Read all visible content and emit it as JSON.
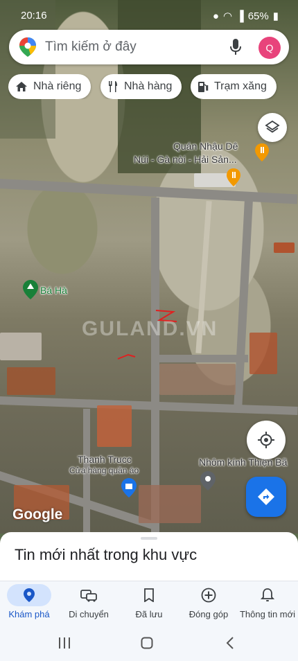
{
  "status": {
    "time": "20:16",
    "battery": "65%"
  },
  "search": {
    "placeholder": "Tìm kiếm ở đây",
    "avatar_letter": "Q"
  },
  "chips": [
    {
      "label": "Nhà riêng",
      "icon": "home-icon"
    },
    {
      "label": "Nhà hàng",
      "icon": "restaurant-icon"
    },
    {
      "label": "Trạm xăng",
      "icon": "gas-station-icon"
    }
  ],
  "map": {
    "places": {
      "quan_nhau_line1": "Quán Nhậu Dê",
      "quan_nhau_line2": "Núi - Gà nòi - Hải Sản...",
      "ba_ha": "Bá Hà",
      "thanh_truc_line1": "Thanh Trucc",
      "thanh_truc_line2": "Cửa hàng quần áo",
      "nhom_kinh": "Nhôm kính Thiện Bã"
    },
    "watermark": "GULAND.VN",
    "logo": "Google",
    "colors": {
      "accent": "#1a73e8",
      "restaurant": "#f29900",
      "park": "#188038",
      "shop": "#1a73e8"
    }
  },
  "sheet": {
    "title": "Tin mới nhất trong khu vực"
  },
  "nav": [
    {
      "label": "Khám phá",
      "icon": "explore-pin-icon",
      "active": true
    },
    {
      "label": "Di chuyển",
      "icon": "car-icon"
    },
    {
      "label": "Đã lưu",
      "icon": "bookmark-icon"
    },
    {
      "label": "Đóng góp",
      "icon": "add-circle-icon"
    },
    {
      "label": "Thông tin mới",
      "icon": "bell-icon"
    }
  ]
}
